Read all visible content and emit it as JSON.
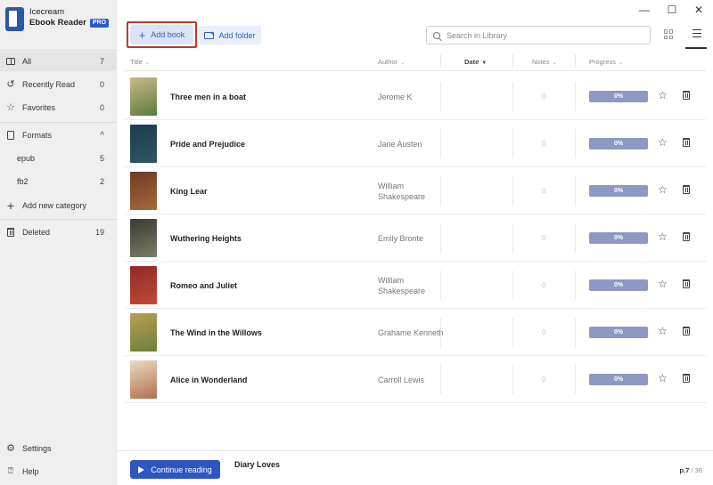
{
  "app": {
    "name_line1": "Icecream",
    "name_line2": "Ebook Reader",
    "badge": "PRO"
  },
  "window_controls": {
    "minimize": "—",
    "maximize": "☐",
    "close": "✕"
  },
  "sidebar": {
    "items": [
      {
        "label": "All",
        "count": "7",
        "icon": "library-icon"
      },
      {
        "label": "Recently Read",
        "count": "0",
        "icon": "history-icon"
      },
      {
        "label": "Favorites",
        "count": "0",
        "icon": "star-icon"
      }
    ],
    "formats": {
      "label": "Formats",
      "icon": "file-icon",
      "chevron": "^"
    },
    "format_items": [
      {
        "label": "epub",
        "count": "5"
      },
      {
        "label": "fb2",
        "count": "2"
      }
    ],
    "add_category": {
      "label": "Add new category",
      "icon": "plus-icon"
    },
    "deleted": {
      "label": "Deleted",
      "count": "19",
      "icon": "trash-icon"
    },
    "settings": {
      "label": "Settings",
      "icon": "gear-icon"
    },
    "help": {
      "label": "Help",
      "icon": "help-icon"
    }
  },
  "toolbar": {
    "add_book": "Add book",
    "add_folder": "Add folder",
    "search_placeholder": "Search in Library"
  },
  "table": {
    "headers": {
      "title": "Title",
      "author": "Author",
      "date": "Date",
      "notes": "Notes",
      "progress": "Progress"
    },
    "rows": [
      {
        "title": "Three men in a boat",
        "author": "Jerome K",
        "notes": "0",
        "progress": "0%",
        "cover_colors": [
          "#c9b98d",
          "#5b7d3a"
        ]
      },
      {
        "title": "Pride and Prejudice",
        "author": "Jane Austen",
        "notes": "0",
        "progress": "0%",
        "cover_colors": [
          "#1d3b4a",
          "#2d5766"
        ]
      },
      {
        "title": "King Lear",
        "author": "William Shakespeare",
        "notes": "0",
        "progress": "0%",
        "cover_colors": [
          "#6b3b22",
          "#a8683c"
        ]
      },
      {
        "title": "Wuthering Heights",
        "author": "Emily Bronte",
        "notes": "0",
        "progress": "0%",
        "cover_colors": [
          "#3a3a32",
          "#7d7b6a"
        ]
      },
      {
        "title": "Romeo and Juliet",
        "author": "William Shakespeare",
        "notes": "0",
        "progress": "0%",
        "cover_colors": [
          "#8e2a24",
          "#c2493a"
        ]
      },
      {
        "title": "The Wind in the Willows",
        "author": "Grahame Kenneth",
        "notes": "0",
        "progress": "0%",
        "cover_colors": [
          "#b99f52",
          "#6d7f3a"
        ]
      },
      {
        "title": "Alice in Wonderland",
        "author": "Carroll Lewis",
        "notes": "0",
        "progress": "0%",
        "cover_colors": [
          "#e8dcc4",
          "#b0704c"
        ]
      }
    ]
  },
  "bottom": {
    "continue_label": "Continue reading",
    "current_book": "Diary Loves",
    "page_prefix": "p.",
    "page_current": "7",
    "page_separator": " / ",
    "page_total": "36"
  },
  "colors": {
    "accent": "#2d56c2",
    "progress_bar": "#8e98c2",
    "highlight": "#c6352e"
  }
}
